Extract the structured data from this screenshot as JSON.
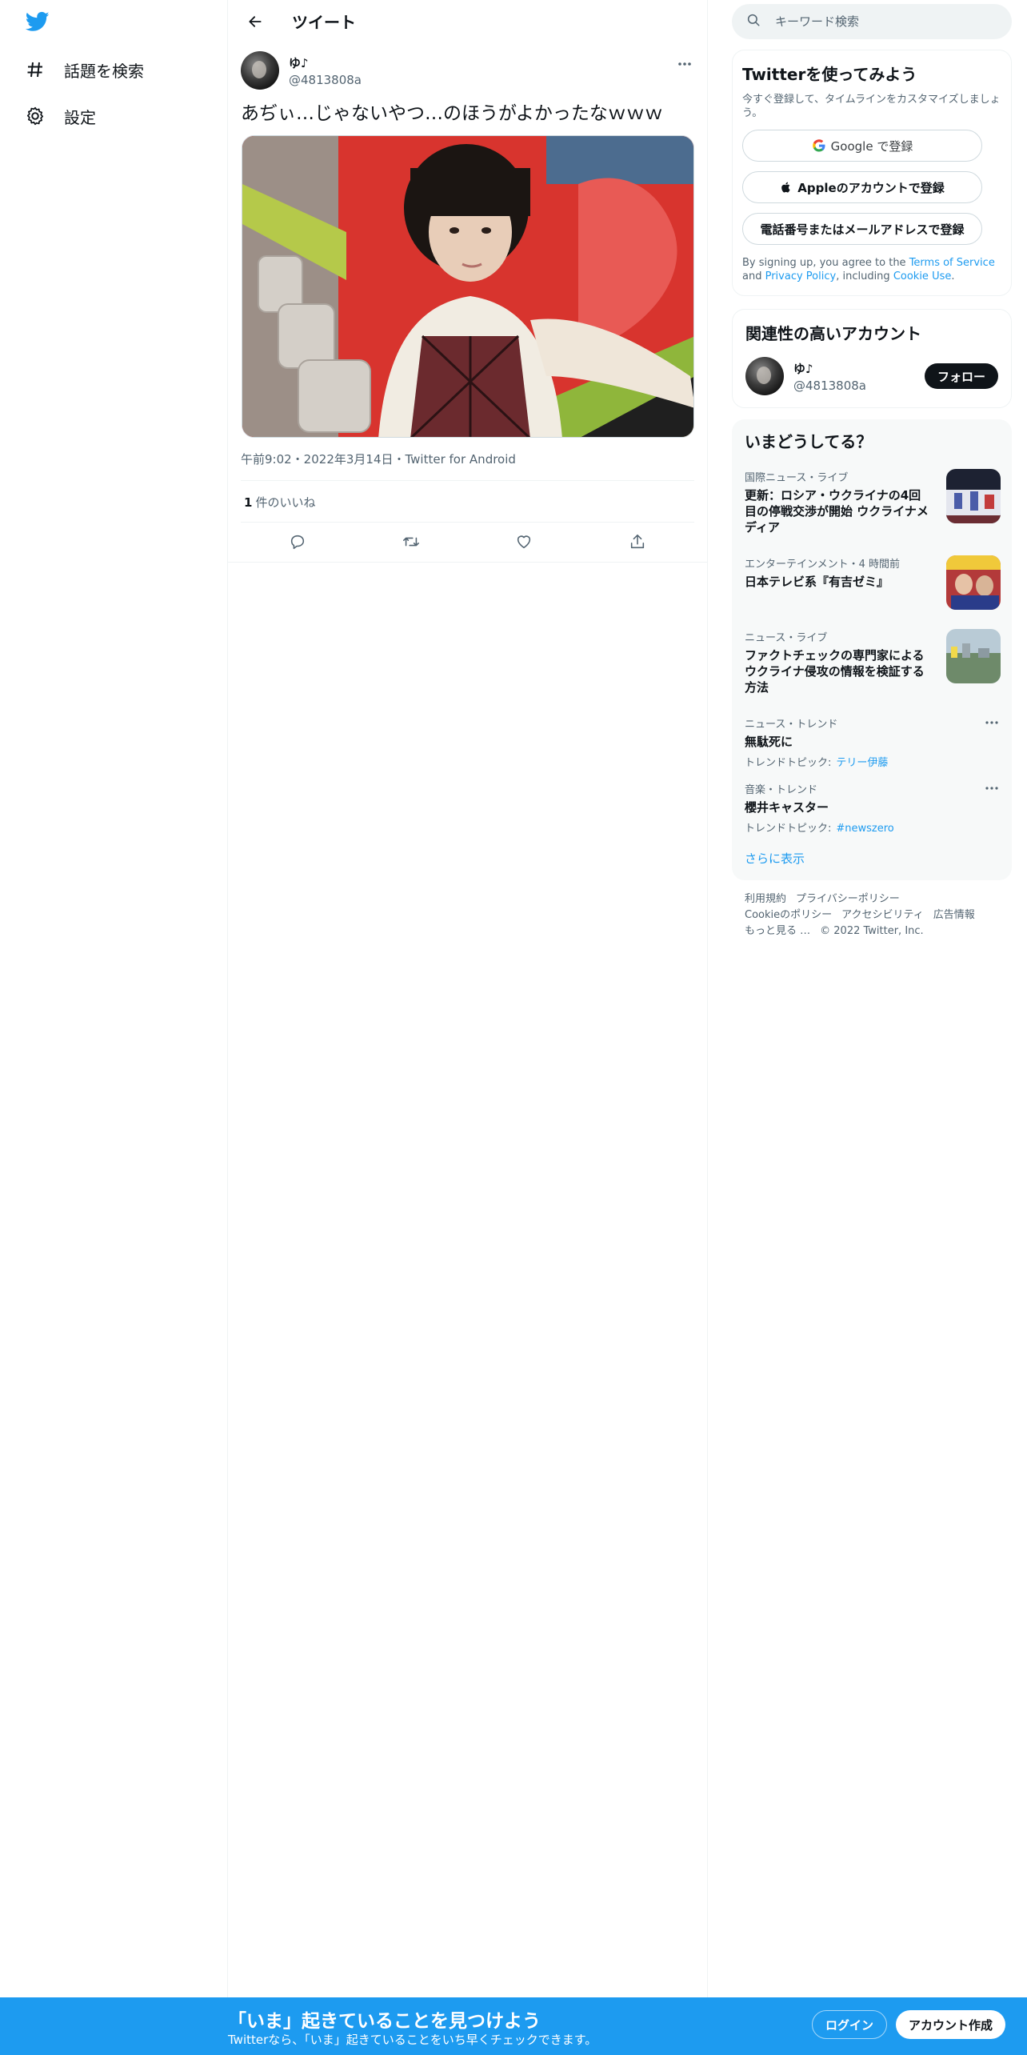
{
  "nav": {
    "items": [
      {
        "label": "話題を検索",
        "icon": "hashtag-icon"
      },
      {
        "label": "設定",
        "icon": "gear-icon"
      }
    ]
  },
  "header": {
    "title": "ツイート"
  },
  "tweet": {
    "author_name": "ゆ♪",
    "author_handle": "@4813808a",
    "text": "あぢぃ…じゃないやつ…のほうがよかったなｗｗｗ",
    "meta": "午前9:02・2022年3月14日・Twitter for Android",
    "likes_count": "1",
    "likes_label": "件のいいね"
  },
  "search": {
    "placeholder": "キーワード検索"
  },
  "signup": {
    "title": "Twitterを使ってみよう",
    "subtitle": "今すぐ登録して、タイムラインをカスタマイズしましょう。",
    "google_label": "Google で登録",
    "apple_label": "Appleのアカウントで登録",
    "phone_label": "電話番号またはメールアドレスで登録",
    "terms_prefix": "By signing up, you agree to the ",
    "terms_link": "Terms of Service",
    "terms_and": " and ",
    "privacy_link": "Privacy Policy",
    "terms_including": ", including ",
    "cookie_link": "Cookie Use",
    "terms_end": "."
  },
  "related": {
    "title": "関連性の高いアカウント",
    "name": "ゆ♪",
    "handle": "@4813808a",
    "follow_label": "フォロー"
  },
  "trends": {
    "title": "いまどうしてる？",
    "items": [
      {
        "category": "国際ニュース・ライブ",
        "title": "更新：ロシア・ウクライナの4回目の停戦交渉が開始 ウクライナメディア"
      },
      {
        "category": "エンターテインメント・4 時間前",
        "title": "日本テレビ系『有吉ゼミ』"
      },
      {
        "category": "ニュース・ライブ",
        "title": "ファクトチェックの専門家によるウクライナ侵攻の情報を検証する方法"
      },
      {
        "category": "ニュース・トレンド",
        "title": "無駄死に",
        "topic_prefix": "トレンドトピック:",
        "topic": "テリー伊藤"
      },
      {
        "category": "音楽・トレンド",
        "title": "櫻井キャスター",
        "topic_prefix": "トレンドトピック:",
        "topic": "#newszero"
      }
    ],
    "show_more": "さらに表示"
  },
  "footer": {
    "links": [
      "利用規約",
      "プライバシーポリシー",
      "Cookieのポリシー",
      "アクセシビリティ",
      "広告情報",
      "もっと見る …",
      "© 2022 Twitter, Inc."
    ]
  },
  "bottom_bar": {
    "title": "「いま」起きていることを見つけよう",
    "subtitle": "Twitterなら、「いま」起きていることをいち早くチェックできます。",
    "login_label": "ログイン",
    "signup_label": "アカウント作成"
  },
  "colors": {
    "accent": "#1d9bf0",
    "text": "#0f1419",
    "secondary": "#536471"
  }
}
